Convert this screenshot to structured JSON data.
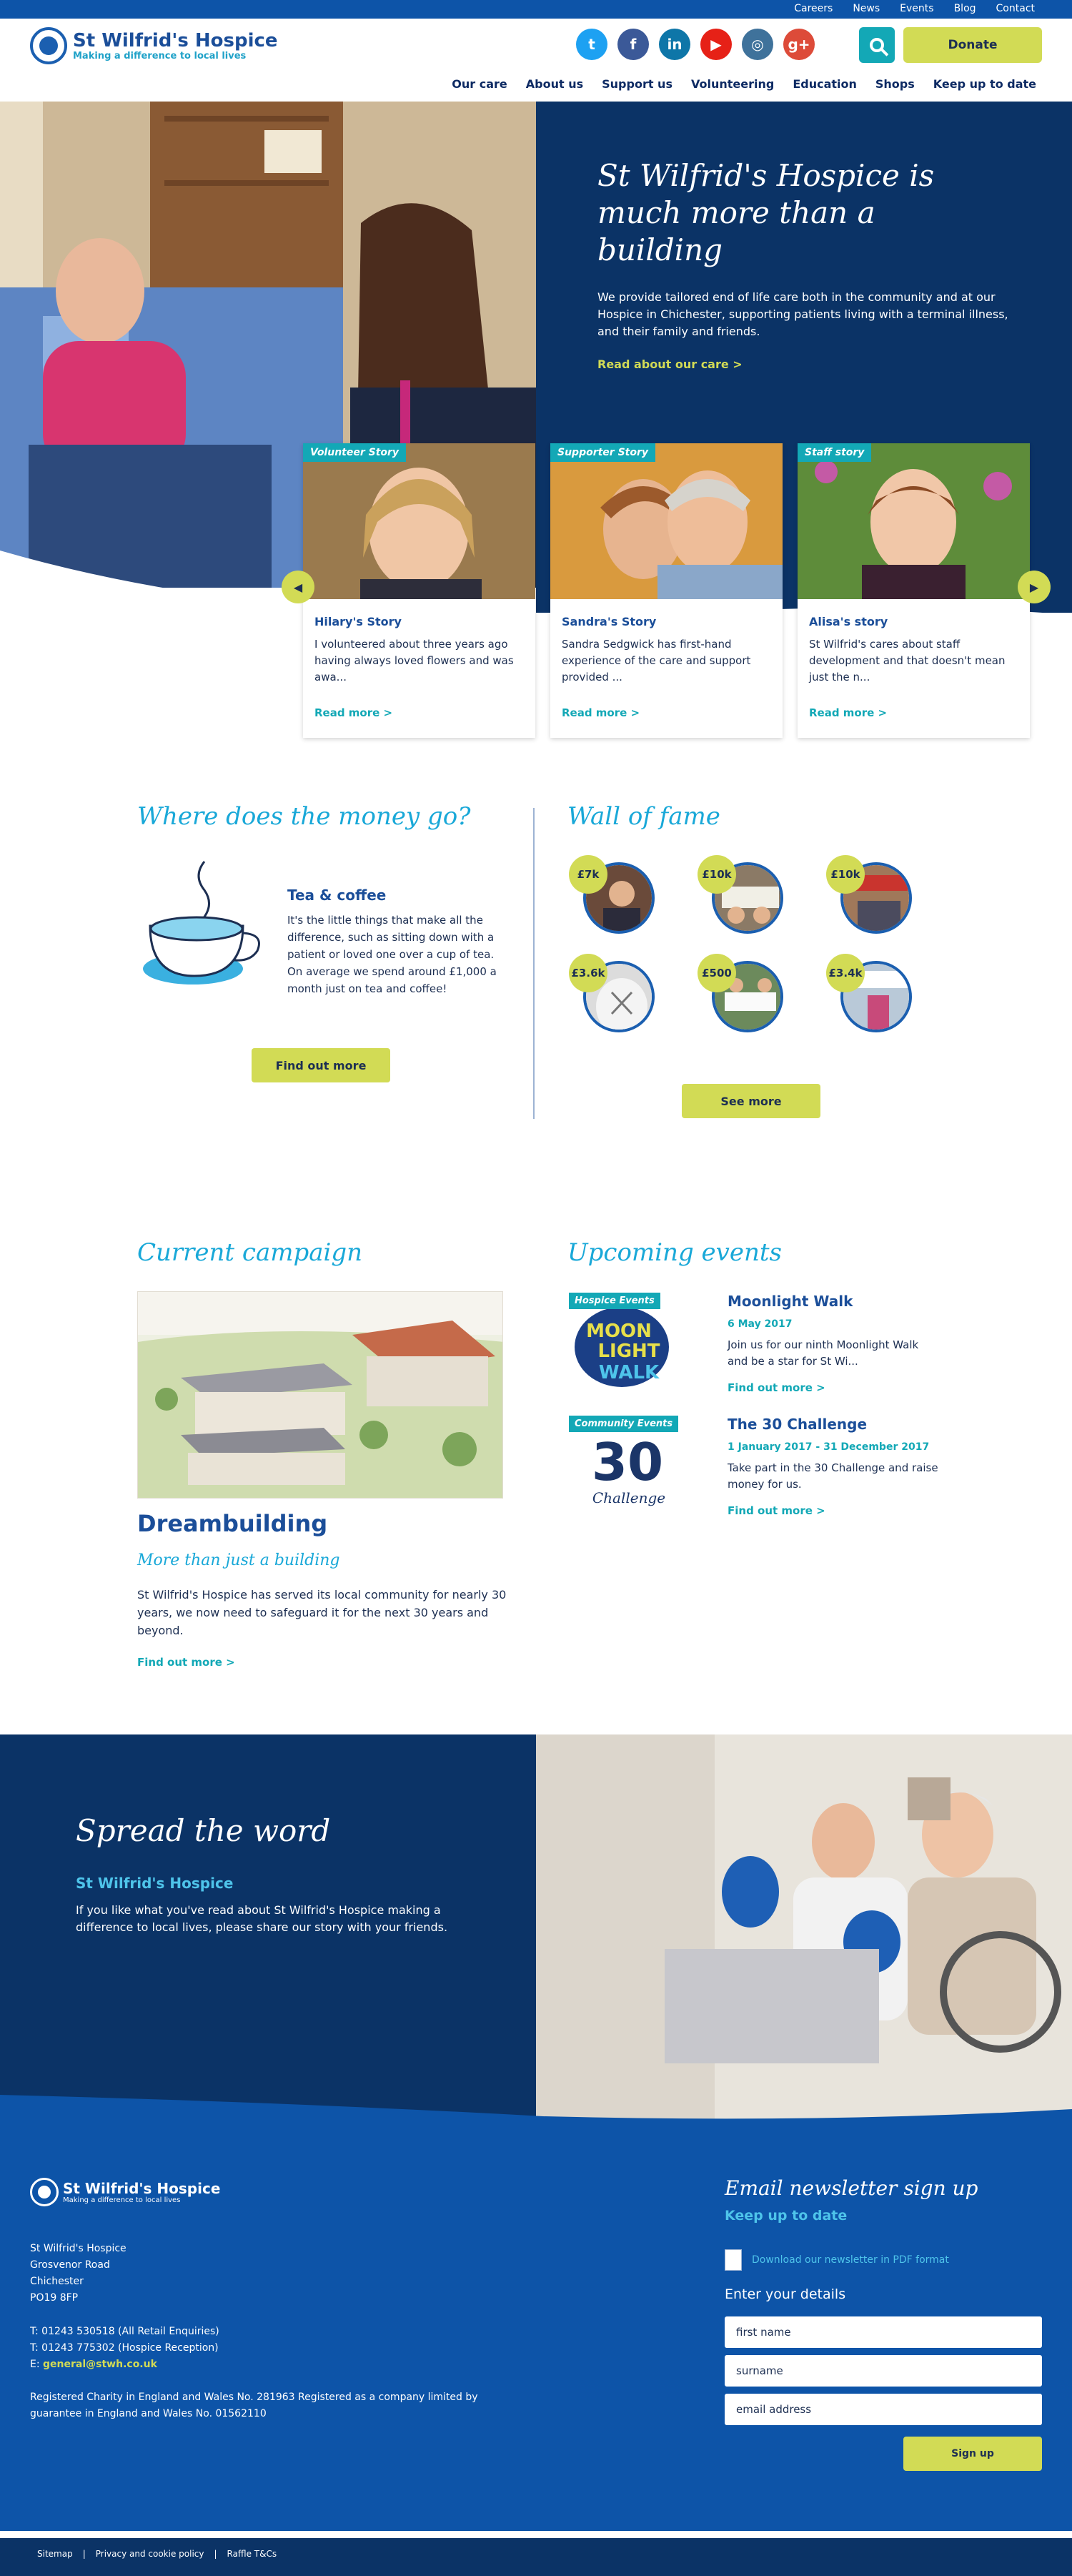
{
  "topbar": {
    "links": [
      "Careers",
      "News",
      "Events",
      "Blog",
      "Contact"
    ]
  },
  "header": {
    "logo_title": "St Wilfrid's Hospice",
    "logo_sub": "Making a difference to local lives",
    "socials": [
      {
        "icon": "twitter-icon",
        "glyph": "t",
        "color": "#1da1f2"
      },
      {
        "icon": "facebook-icon",
        "glyph": "f",
        "color": "#3b5998"
      },
      {
        "icon": "linkedin-icon",
        "glyph": "in",
        "color": "#0e76a8"
      },
      {
        "icon": "youtube-icon",
        "glyph": "▶",
        "color": "#e62117"
      },
      {
        "icon": "instagram-icon",
        "glyph": "◎",
        "color": "#3f729b"
      },
      {
        "icon": "googleplus-icon",
        "glyph": "g+",
        "color": "#dd4b39"
      }
    ],
    "donate_label": "Donate",
    "nav": [
      "Our care",
      "About us",
      "Support us",
      "Volunteering",
      "Education",
      "Shops",
      "Keep up to date"
    ]
  },
  "hero": {
    "title": "St Wilfrid's Hospice is much more than a building",
    "text": "We provide tailored end of life care both in the community and at our Hospice in Chichester, supporting patients living with a terminal illness, and their family and friends.",
    "link": "Read about our care >"
  },
  "stories": [
    {
      "tag": "Volunteer Story",
      "name": "Hilary's Story",
      "text": "I volunteered about three years ago having always loved flowers and was awa...",
      "link": "Read more >"
    },
    {
      "tag": "Supporter Story",
      "name": "Sandra's Story",
      "text": "Sandra Sedgwick has first-hand experience of the care and support provided ...",
      "link": "Read more >"
    },
    {
      "tag": "Staff story",
      "name": "Alisa's story",
      "text": "St Wilfrid's cares about staff development and that doesn't mean just the n...",
      "link": "Read more >"
    }
  ],
  "money": {
    "heading": "Where does the money go?",
    "title": "Tea & coffee",
    "text": "It's the little things that make all the difference, such as sitting down with a patient or loved one over a cup of tea. On average we spend around £1,000 a month just on tea and coffee!",
    "button": "Find out more"
  },
  "fame": {
    "heading": "Wall of fame",
    "items": [
      "£7k",
      "£10k",
      "£10k",
      "£3.6k",
      "£500",
      "£3.4k"
    ],
    "button": "See more"
  },
  "campaign": {
    "heading": "Current campaign",
    "title": "Dreambuilding",
    "subtitle": "More than just a building",
    "text": "St Wilfrid's Hospice has served its local community for nearly 30 years, we now need to safeguard it for the next 30 years and beyond.",
    "link": "Find out more >"
  },
  "events": {
    "heading": "Upcoming events",
    "items": [
      {
        "tag": "Hospice Events",
        "art": "MOON LIGHT WALK",
        "title": "Moonlight Walk",
        "date": "6 May 2017",
        "desc": "Join us for our ninth Moonlight Walk and be a star for St Wi...",
        "link": "Find out more >"
      },
      {
        "tag": "Community Events",
        "art": "30",
        "art_sub": "Challenge",
        "title": "The 30 Challenge",
        "date": "1 January 2017 - 31 December 2017",
        "desc": "Take part in the 30 Challenge and raise money for us.",
        "link": "Find out more >"
      }
    ]
  },
  "spread": {
    "title": "Spread the word",
    "subtitle": "St Wilfrid's Hospice",
    "text": "If you like what you've read about St Wilfrid's Hospice making a difference to local lives, please share our story with your friends."
  },
  "footer": {
    "logo_title": "St Wilfrid's Hospice",
    "logo_sub": "Making a difference to local lives",
    "address": [
      "St Wilfrid's Hospice",
      "Grosvenor Road",
      "Chichester",
      "PO19 8FP"
    ],
    "phones": [
      "T: 01243 530518 (All Retail Enquiries)",
      "T: 01243 775302 (Hospice Reception)"
    ],
    "email_label": "E: ",
    "email": "general@stwh.co.uk",
    "charity": "Registered Charity in England and Wales No. 281963 Registered as a company limited by guarantee in England and Wales No. 01562110",
    "newsletter_title": "Email newsletter sign up",
    "newsletter_sub": "Keep up to date",
    "pdf_link": "Download our newsletter in PDF format",
    "details_label": "Enter your details",
    "first_name_placeholder": "first name",
    "surname_placeholder": "surname",
    "email_placeholder": "email address",
    "signup_label": "Sign up",
    "bottom_links": [
      "Sitemap",
      "Privacy and cookie policy",
      "Raffle T&Cs"
    ]
  },
  "colors": {
    "brand_blue": "#0d54a8",
    "navy": "#0b3366",
    "teal": "#13a8b6",
    "lime": "#d2db55",
    "sky": "#19a8d8"
  }
}
